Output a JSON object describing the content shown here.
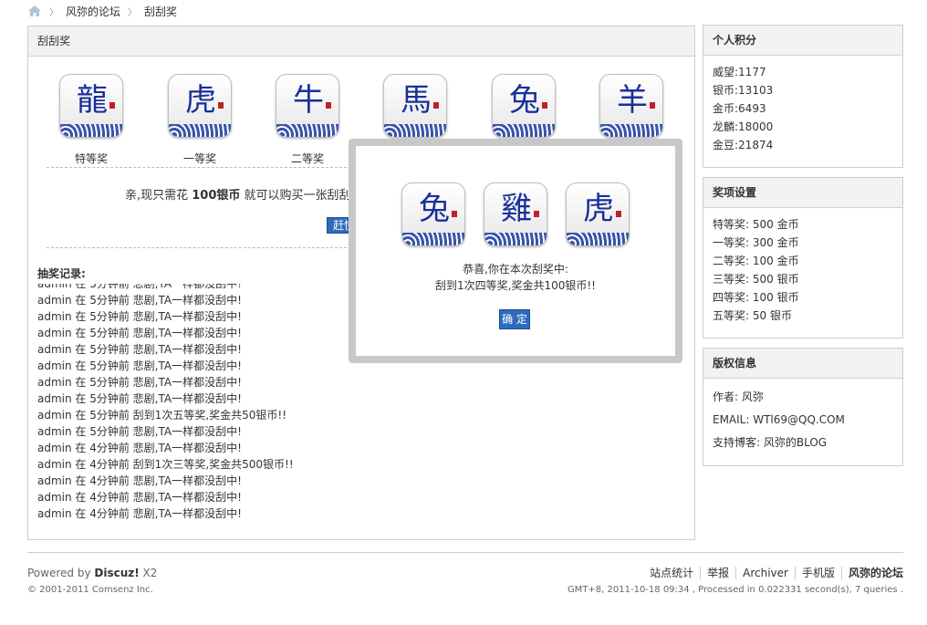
{
  "breadcrumb": {
    "home_icon": "home-icon",
    "items": [
      "风弥的论坛",
      "刮刮奖"
    ]
  },
  "main": {
    "title": "刮刮奖",
    "tiles": [
      {
        "icon": "dragon-icon",
        "glyph": "龍",
        "label": "特等奖"
      },
      {
        "icon": "tiger-icon",
        "glyph": "虎",
        "label": "一等奖"
      },
      {
        "icon": "ox-icon",
        "glyph": "牛",
        "label": "二等奖"
      },
      {
        "icon": "horse-icon",
        "glyph": "馬",
        "label": ""
      },
      {
        "icon": "rabbit-icon",
        "glyph": "兔",
        "label": ""
      },
      {
        "icon": "goat-icon",
        "glyph": "羊",
        "label": ""
      }
    ],
    "buy_text_pre": "亲,现只需花 ",
    "buy_price": "100银币",
    "buy_text_post": " 就可以购买一张刮刮奖彩",
    "go_button": "赶快",
    "records_title": "抽奖记录:",
    "records": [
      "admin 在 5分钟前 悲剧,TA一样都没刮中!",
      "admin 在 5分钟前 悲剧,TA一样都没刮中!",
      "admin 在 5分钟前 悲剧,TA一样都没刮中!",
      "admin 在 5分钟前 悲剧,TA一样都没刮中!",
      "admin 在 5分钟前 悲剧,TA一样都没刮中!",
      "admin 在 5分钟前 悲剧,TA一样都没刮中!",
      "admin 在 5分钟前 悲剧,TA一样都没刮中!",
      "admin 在 5分钟前 悲剧,TA一样都没刮中!",
      "admin 在 5分钟前 刮到1次五等奖,奖金共50银币!!",
      "admin 在 5分钟前 悲剧,TA一样都没刮中!",
      "admin 在 4分钟前 悲剧,TA一样都没刮中!",
      "admin 在 4分钟前 刮到1次三等奖,奖金共500银币!!",
      "admin 在 4分钟前 悲剧,TA一样都没刮中!",
      "admin 在 4分钟前 悲剧,TA一样都没刮中!",
      "admin 在 4分钟前 悲剧,TA一样都没刮中!"
    ]
  },
  "sidebar": {
    "points": {
      "title": "个人积分",
      "lines": [
        "威望:1177",
        "银币:13103",
        "金币:6493",
        "龙麟:18000",
        "金豆:21874"
      ]
    },
    "prizes": {
      "title": "奖项设置",
      "lines": [
        "特等奖: 500 金币",
        "一等奖: 300 金币",
        "二等奖: 100 金币",
        "三等奖: 500 银币",
        "四等奖: 100 银币",
        "五等奖: 50 银币"
      ]
    },
    "copyright": {
      "title": "版权信息",
      "lines": [
        "作者: 风弥",
        "EMAIL: WTl69@QQ.COM",
        "支持博客: 风弥的BLOG"
      ]
    }
  },
  "footer": {
    "powered_pre": "Powered by ",
    "powered_brand": "Discuz!",
    "powered_ver": " X2",
    "copyright": "© 2001-2011 Comsenz Inc.",
    "links": [
      "站点统计",
      "举报",
      "Archiver",
      "手机版",
      "风弥的论坛"
    ],
    "stats": "GMT+8, 2011-10-18 09:34 , Processed in 0.022331 second(s), 7 queries ."
  },
  "dialog": {
    "tiles": [
      {
        "icon": "rabbit-icon",
        "glyph": "兔"
      },
      {
        "icon": "rooster-icon",
        "glyph": "雞"
      },
      {
        "icon": "tiger-icon",
        "glyph": "虎"
      }
    ],
    "message1": "恭喜,你在本次刮奖中:",
    "message2": "刮到1次四等奖,奖金共100银币!!",
    "ok_button": "确 定"
  },
  "colors": {
    "accent": "#2d6bbd",
    "border": "#cdcdcd",
    "header_bg": "#f2f2f2",
    "porcelain_blue": "#1a2f99",
    "seal_red": "#c0202a"
  }
}
